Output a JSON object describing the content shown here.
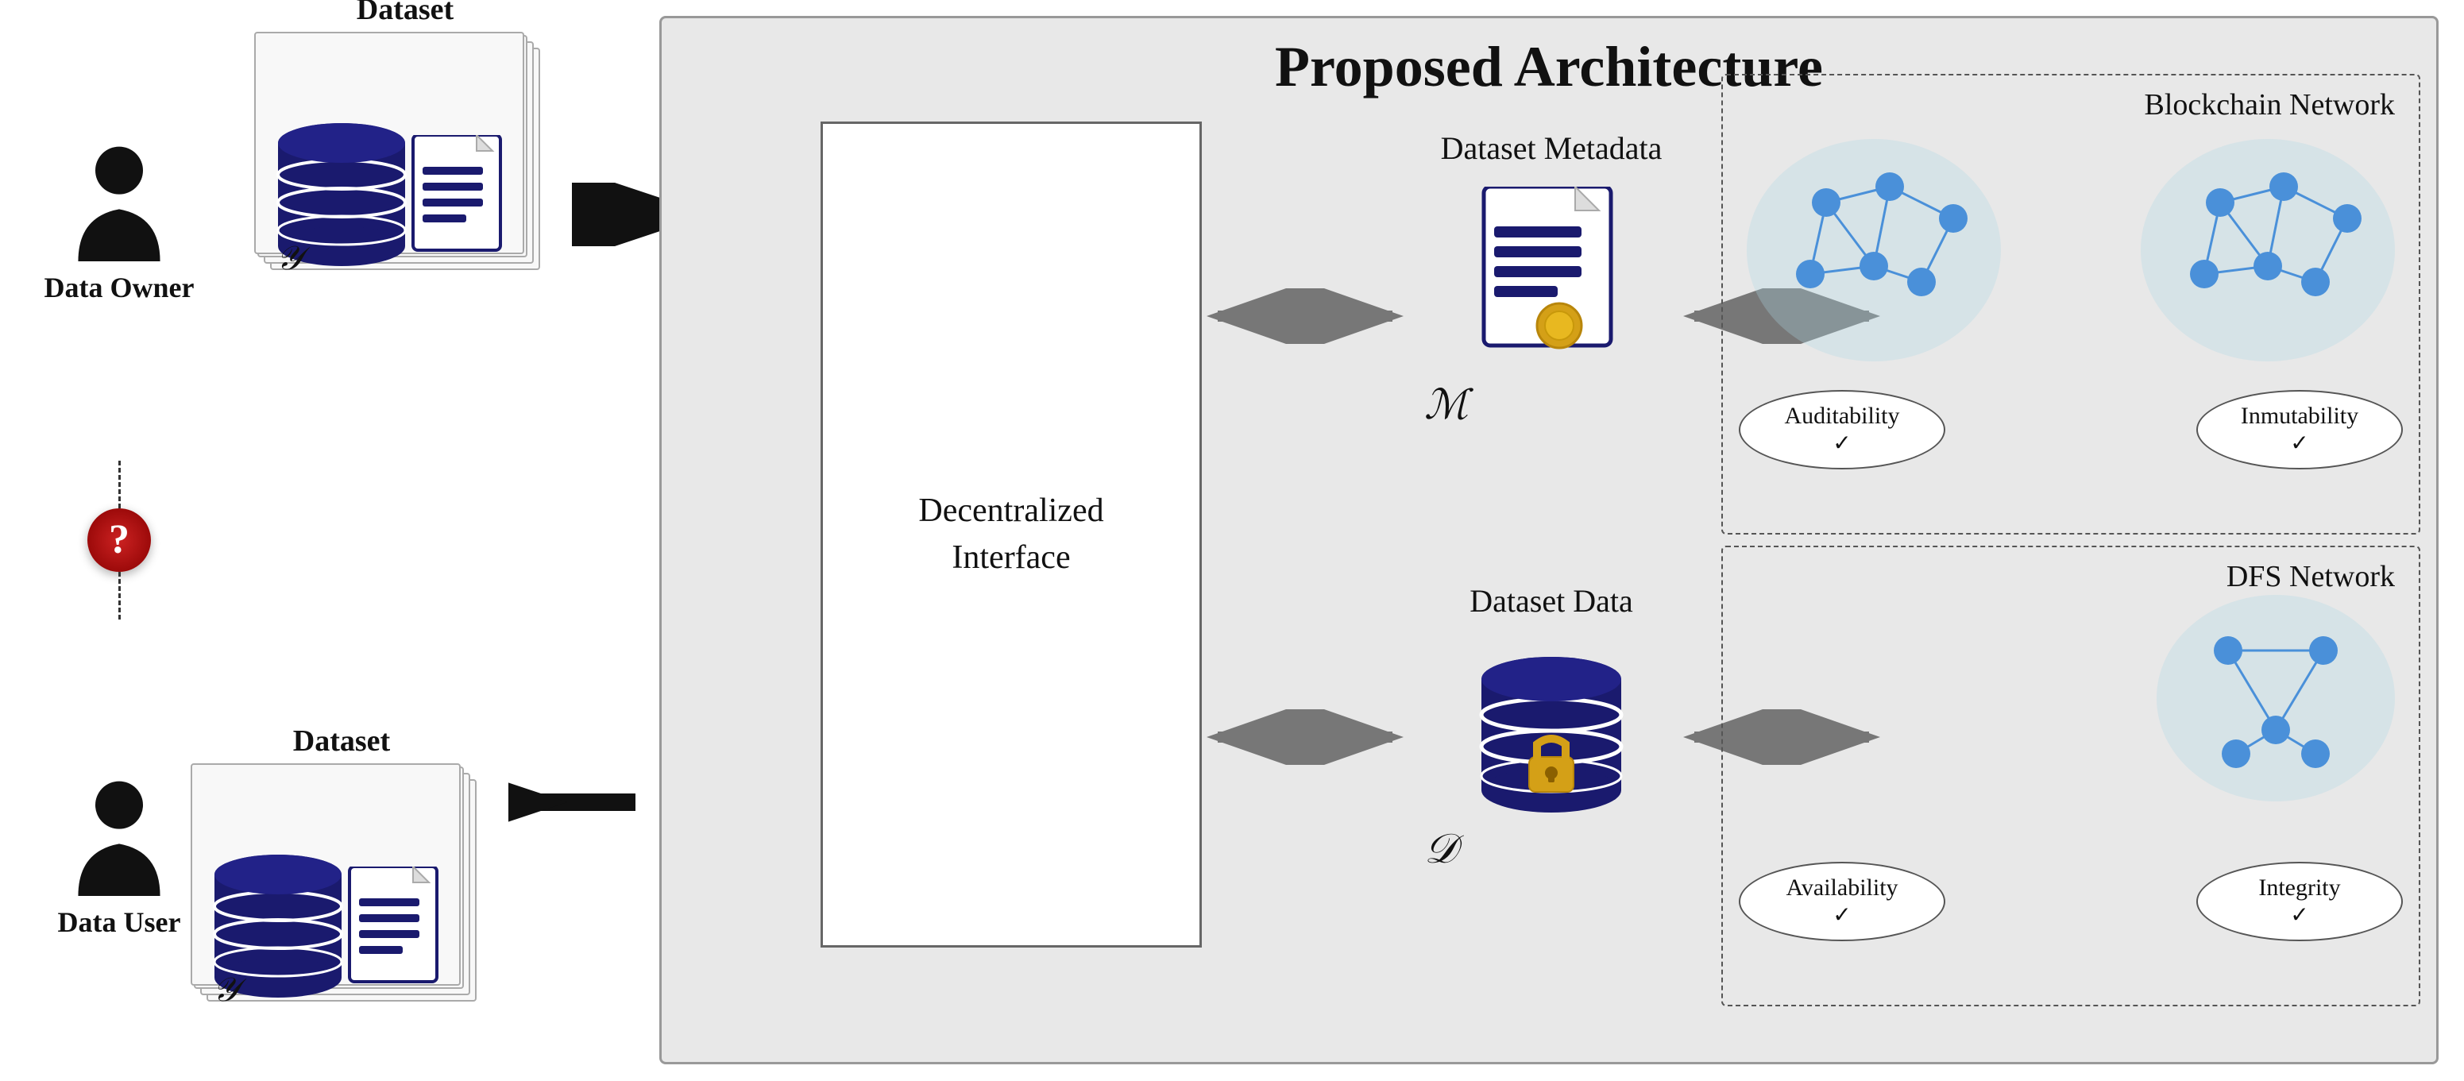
{
  "title": "Proposed Architecture",
  "actors": {
    "data_owner": {
      "label": "Data Owner"
    },
    "data_user": {
      "label": "Data User"
    },
    "question_mark": "?"
  },
  "datasets": {
    "top": {
      "title": "Dataset",
      "y_label": "𝒴"
    },
    "bottom": {
      "title": "Dataset",
      "y_label": "𝒴"
    }
  },
  "interface": {
    "label": "Decentralized\nInterface"
  },
  "metadata_section": {
    "title": "Dataset Metadata",
    "symbol": "ℳ"
  },
  "data_section": {
    "title": "Dataset Data",
    "symbol": "𝒟"
  },
  "blockchain_network": {
    "label": "Blockchain Network",
    "properties": [
      {
        "name": "Auditability",
        "check": "✓"
      },
      {
        "name": "Inmutability",
        "check": "✓"
      }
    ]
  },
  "dfs_network": {
    "label": "DFS Network",
    "properties": [
      {
        "name": "Availability",
        "check": "✓"
      },
      {
        "name": "Integrity",
        "check": "✓"
      }
    ]
  }
}
